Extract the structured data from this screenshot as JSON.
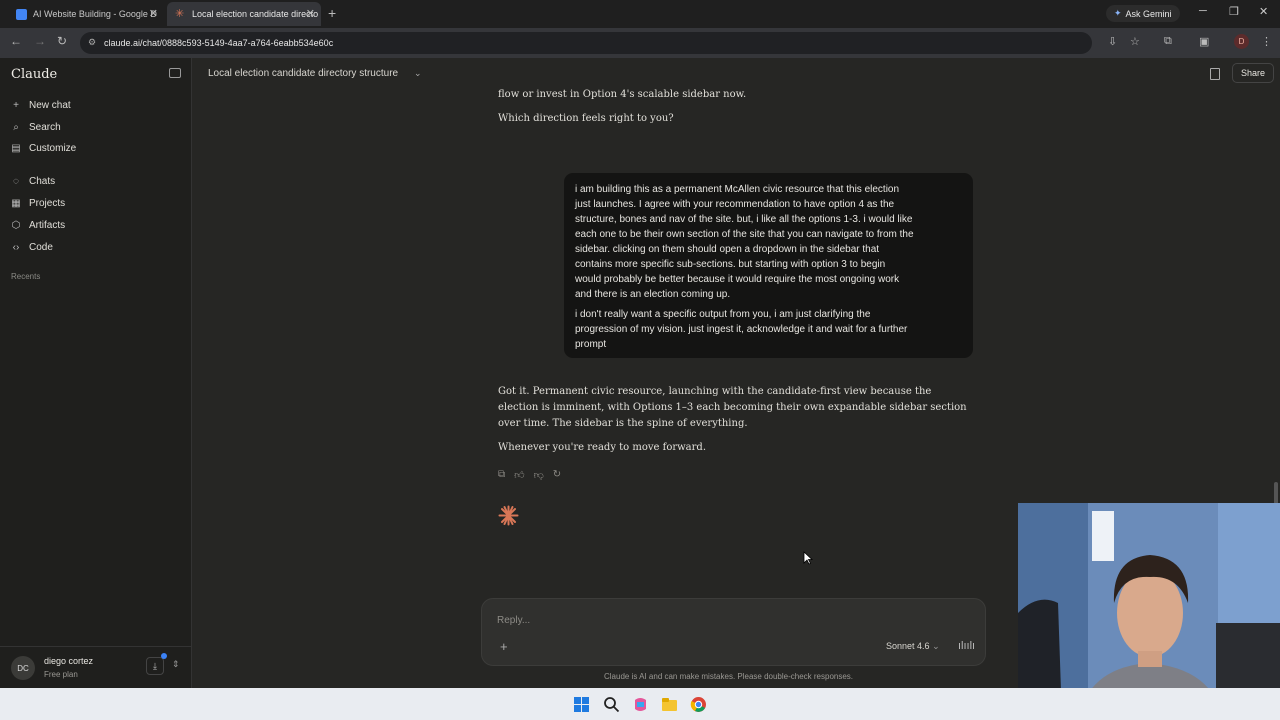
{
  "browser": {
    "tabs": [
      {
        "title": "AI Website Building - Google D"
      },
      {
        "title": "Local election candidate directo"
      }
    ],
    "ask_gemini": "Ask Gemini",
    "url": "claude.ai/chat/0888c593-5149-4aa7-a764-6eabb534e60c",
    "profile_initial": "D"
  },
  "sidebar": {
    "brand": "Claude",
    "items": [
      {
        "label": "New chat",
        "icon": "plus-icon"
      },
      {
        "label": "Search",
        "icon": "search-icon"
      },
      {
        "label": "Customize",
        "icon": "briefcase-icon"
      },
      {
        "label": "Chats",
        "icon": "chat-icon"
      },
      {
        "label": "Projects",
        "icon": "grid-icon"
      },
      {
        "label": "Artifacts",
        "icon": "artifact-icon"
      },
      {
        "label": "Code",
        "icon": "code-icon"
      }
    ],
    "recents_label": "Recents",
    "user": {
      "initials": "DC",
      "name": "diego cortez",
      "plan": "Free plan"
    }
  },
  "header": {
    "title": "Local election candidate directory structure",
    "share_label": "Share"
  },
  "conversation": {
    "ai_partial": "flow or invest in Option 4's scalable sidebar now.",
    "ai_question": "Which direction feels right to you?",
    "user_message": {
      "lines": [
        "i am building this as a permanent McAllen civic resource that this election",
        "just launches. I agree with your recommendation to have option 4 as the",
        "structure, bones and nav of the site. but, i like all the options 1-3. i would like",
        "each one to be their own section of the site that you can navigate to from the",
        "sidebar. clicking on them should open a dropdown in the sidebar that",
        "contains more specific sub-sections. but starting with option 3 to begin",
        "would probably be better because it would require the most ongoing work",
        "and there is an election coming up."
      ],
      "lines2": [
        "i don't really want a specific output from you, i am just clarifying the",
        "progression of my vision. just ingest it, acknowledge it and wait for a further",
        "prompt"
      ]
    },
    "ai_reply": {
      "lines": [
        "Got it. Permanent civic resource, launching with the candidate-first view because the",
        "election is imminent, with Options 1–3 each becoming their own expandable sidebar section",
        "over time. The sidebar is the spine of everything."
      ],
      "closing": "Whenever you're ready to move forward."
    }
  },
  "composer": {
    "placeholder": "Reply...",
    "model": "Sonnet 4.6",
    "disclaimer": "Claude is AI and can make mistakes. Please double-check responses."
  },
  "colors": {
    "accent": "#d97757",
    "background": "#262624",
    "sidebar": "#1f1f1d",
    "user_bubble": "#141413"
  }
}
